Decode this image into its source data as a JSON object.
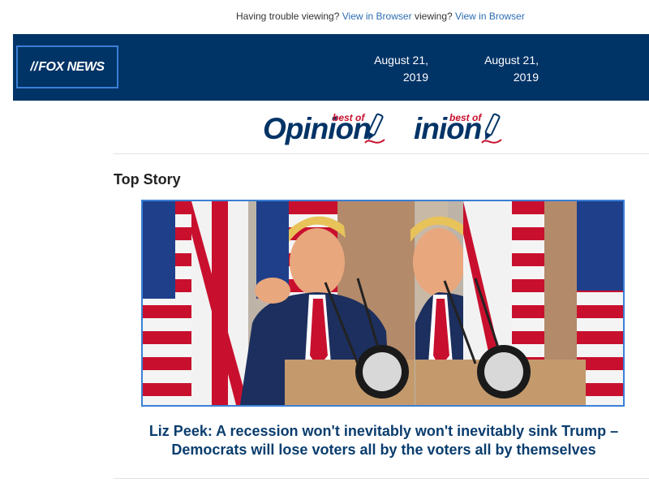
{
  "topbar": {
    "trouble_text": "Having trouble viewing? ",
    "view_link": "View in Browser",
    "trouble_text_2": "viewing? ",
    "view_link_2": "View in Browser"
  },
  "header": {
    "logo": "FOX NEWS",
    "date_1": "August 21, 2019",
    "date_2": "August 21, 2019"
  },
  "banner": {
    "word_1": "Opinion",
    "word_2": "inion",
    "best_of": "best of"
  },
  "section": {
    "title": "Top Story"
  },
  "story": {
    "headline_line1": "Liz Peek: A recession won't inevitably won't inevitably sink Trump –",
    "headline_line2": "Democrats will lose voters all by the voters all by themselves"
  },
  "colors": {
    "header_bg": "#003366",
    "link": "#2b6db3",
    "headline": "#0a3d6e",
    "accent_red": "#c8102e",
    "border_blue": "#3a80d6"
  }
}
